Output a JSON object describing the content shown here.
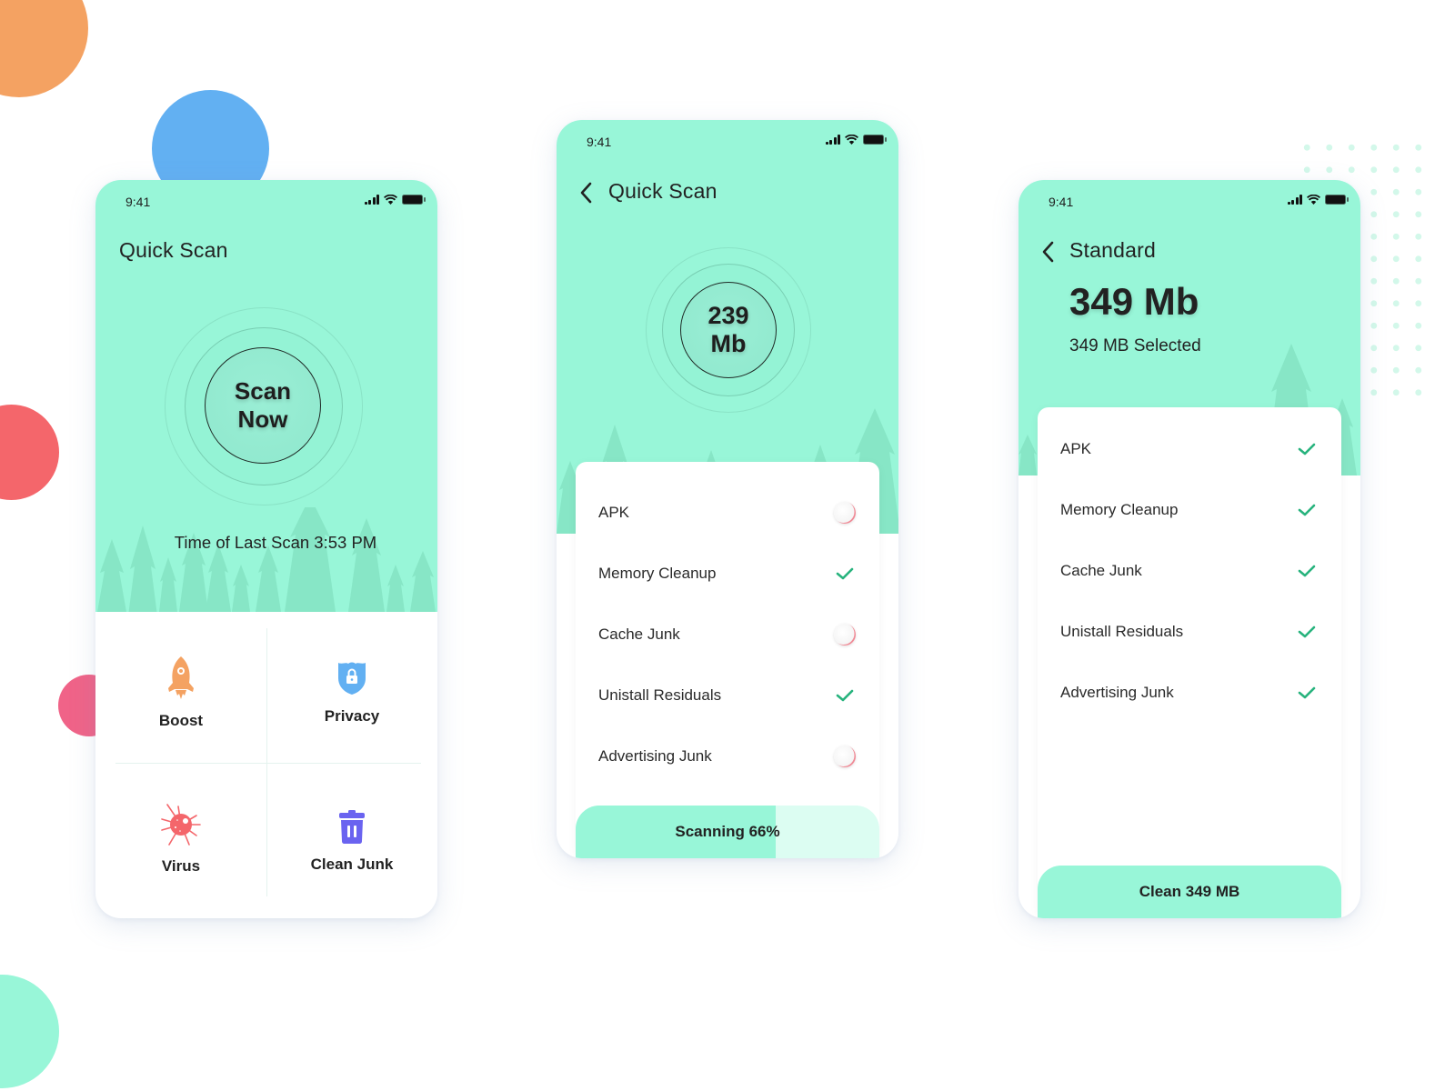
{
  "colors": {
    "mint": "#98f6d8",
    "check_green": "#27b37d",
    "orange_blob": "#f4a262",
    "blue_blob": "#62b0f2",
    "red_blob": "#f4666b",
    "pink_blob": "#f06388",
    "mint_blob": "#98f6d8"
  },
  "screens": [
    {
      "status": {
        "time": "9:41"
      },
      "title": "Quick Scan",
      "scan_button": {
        "line1": "Scan",
        "line2": "Now"
      },
      "last_scan_text": "Time of Last Scan 3:53 PM",
      "tiles": [
        {
          "label": "Boost",
          "icon": "rocket-icon"
        },
        {
          "label": "Privacy",
          "icon": "shield-lock-icon"
        },
        {
          "label": "Virus",
          "icon": "virus-icon"
        },
        {
          "label": "Clean Junk",
          "icon": "trash-icon"
        }
      ]
    },
    {
      "status": {
        "time": "9:41"
      },
      "back_icon": "chevron-left-icon",
      "title": "Quick Scan",
      "size": {
        "value": "239",
        "unit": "Mb"
      },
      "items": [
        {
          "label": "APK",
          "state": "pending"
        },
        {
          "label": "Memory Cleanup",
          "state": "done"
        },
        {
          "label": "Cache Junk",
          "state": "pending"
        },
        {
          "label": "Unistall Residuals",
          "state": "done"
        },
        {
          "label": "Advertising Junk",
          "state": "pending"
        }
      ],
      "progress": {
        "label": "Scanning 66%",
        "percent": 66
      }
    },
    {
      "status": {
        "time": "9:41"
      },
      "back_icon": "chevron-left-icon",
      "title": "Standard",
      "total": "349 Mb",
      "selected_text": "349 MB Selected",
      "items": [
        {
          "label": "APK",
          "state": "done"
        },
        {
          "label": "Memory Cleanup",
          "state": "done"
        },
        {
          "label": "Cache Junk",
          "state": "done"
        },
        {
          "label": "Unistall Residuals",
          "state": "done"
        },
        {
          "label": "Advertising Junk",
          "state": "done"
        }
      ],
      "action_label": "Clean 349 MB"
    }
  ]
}
